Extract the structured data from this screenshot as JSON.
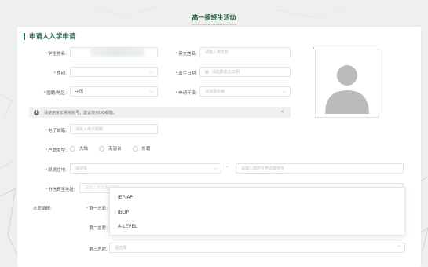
{
  "page": {
    "title": "高一插班生活动"
  },
  "form": {
    "section_title": "申请人入学申请",
    "name_label": "学生姓名:",
    "english_name_label": "英文姓名:",
    "english_name_placeholder": "请输入英文名",
    "gender_label": "性别:",
    "birthdate_label": "出生日期:",
    "birthdate_placeholder": "请选择出生日期",
    "nationality_label": "国籍/地区:",
    "nationality_value": "中国",
    "grade_label": "申请年级:",
    "grade_placeholder": "请选择年级",
    "notice_text": "请使用家长常用账号，建议使用QQ邮箱。",
    "email_label": "电子邮箱:",
    "email_placeholder": "请输入电子邮箱",
    "hukou_label": "户籍类型:",
    "hukou_options": [
      "大陆",
      "港澳台",
      "外籍"
    ],
    "address_label": "现居住地:",
    "address_province_placeholder": "请选择",
    "address_detail_placeholder": "请输入现居住地详细地址",
    "mail_address_label": "书信寄至地址:",
    "mail_address_placeholder": "请输入书信寄至地址",
    "preference_label": "志愿填报:",
    "pref1_label": "第一志愿:",
    "pref2_label": "第二志愿:",
    "pref3_label": "第三志愿:",
    "pref3_placeholder": "请选择"
  },
  "dropdown": {
    "options": [
      "IEP/AP",
      "IBDP",
      "A-LEVEL"
    ]
  },
  "icons": {
    "notice": "info-icon",
    "close": "close-icon",
    "chevron": "chevron-down-icon",
    "calendar": "calendar-icon",
    "avatar": "avatar-placeholder-icon"
  },
  "colors": {
    "brand_green": "#2a6b4a",
    "required": "#e56060",
    "avatar_gray": "#b9bcbb"
  }
}
